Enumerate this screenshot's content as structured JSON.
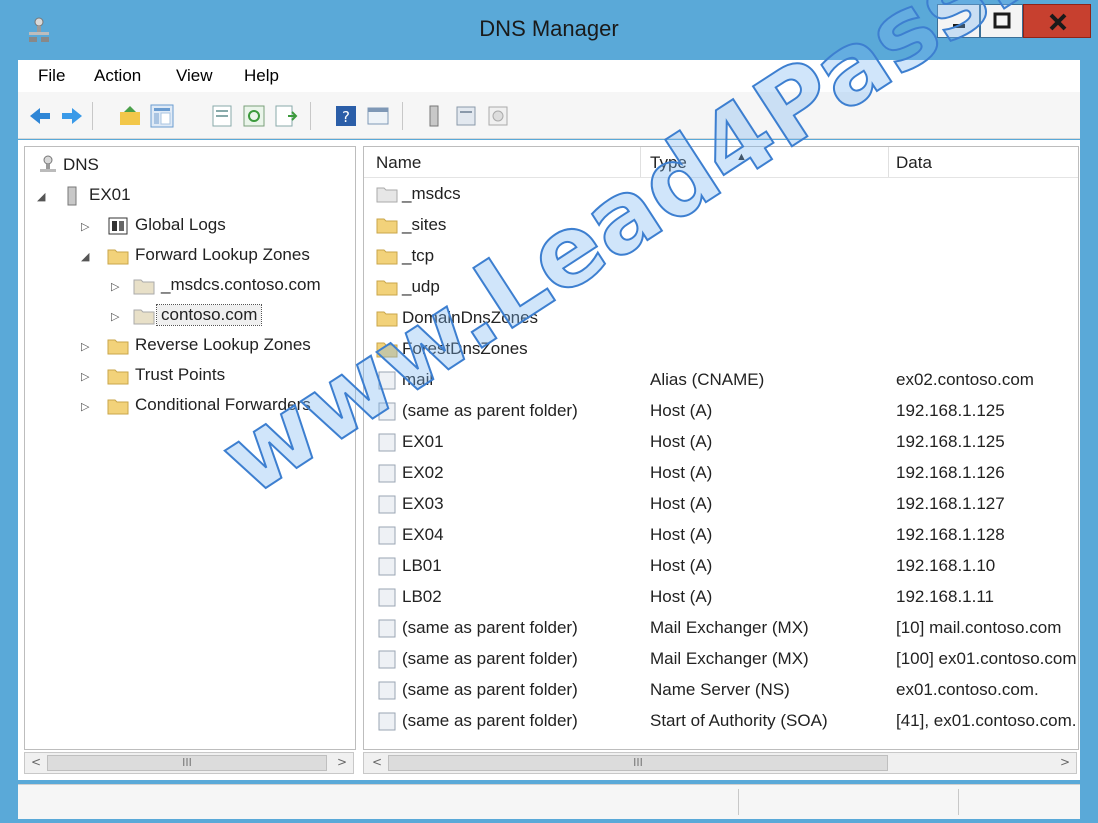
{
  "window": {
    "title": "DNS Manager"
  },
  "menu": [
    "File",
    "Action",
    "View",
    "Help"
  ],
  "toolbar": {
    "icons": [
      "back-arrow-icon",
      "forward-arrow-icon",
      "up-folder-icon",
      "show-hide-tree-icon",
      "properties-icon",
      "refresh-icon",
      "export-list-icon",
      "help-icon",
      "console-icon",
      "server-icon",
      "zone-icon",
      "record-icon"
    ]
  },
  "tree": {
    "root": "DNS",
    "server": "EX01",
    "global_logs": "Global Logs",
    "forward_zones": "Forward Lookup Zones",
    "msdcs_zone": "_msdcs.contoso.com",
    "contoso_zone": "contoso.com",
    "reverse_zones": "Reverse Lookup Zones",
    "trust_points": "Trust Points",
    "conditional_forwarders": "Conditional Forwarders"
  },
  "list": {
    "columns": {
      "name": "Name",
      "type": "Type",
      "data": "Data"
    },
    "rows": [
      {
        "name": "_msdcs",
        "type": "",
        "data": "",
        "icon": "delegated-folder-icon"
      },
      {
        "name": "_sites",
        "type": "",
        "data": "",
        "icon": "folder-icon"
      },
      {
        "name": "_tcp",
        "type": "",
        "data": "",
        "icon": "folder-icon"
      },
      {
        "name": "_udp",
        "type": "",
        "data": "",
        "icon": "folder-icon"
      },
      {
        "name": "DomainDnsZones",
        "type": "",
        "data": "",
        "icon": "folder-icon"
      },
      {
        "name": "ForestDnsZones",
        "type": "",
        "data": "",
        "icon": "folder-icon"
      },
      {
        "name": "mail",
        "type": "Alias (CNAME)",
        "data": "ex02.contoso.com",
        "icon": "record-icon"
      },
      {
        "name": "(same as parent folder)",
        "type": "Host (A)",
        "data": "192.168.1.125",
        "icon": "record-icon"
      },
      {
        "name": "EX01",
        "type": "Host (A)",
        "data": "192.168.1.125",
        "icon": "record-icon"
      },
      {
        "name": "EX02",
        "type": "Host (A)",
        "data": "192.168.1.126",
        "icon": "record-icon"
      },
      {
        "name": "EX03",
        "type": "Host (A)",
        "data": "192.168.1.127",
        "icon": "record-icon"
      },
      {
        "name": "EX04",
        "type": "Host (A)",
        "data": "192.168.1.128",
        "icon": "record-icon"
      },
      {
        "name": "LB01",
        "type": "Host (A)",
        "data": "192.168.1.10",
        "icon": "record-icon"
      },
      {
        "name": "LB02",
        "type": "Host (A)",
        "data": "192.168.1.11",
        "icon": "record-icon"
      },
      {
        "name": "(same as parent folder)",
        "type": "Mail Exchanger (MX)",
        "data": "[10]  mail.contoso.com",
        "icon": "record-icon"
      },
      {
        "name": "(same as parent folder)",
        "type": "Mail Exchanger (MX)",
        "data": "[100]  ex01.contoso.com",
        "icon": "record-icon"
      },
      {
        "name": "(same as parent folder)",
        "type": "Name Server (NS)",
        "data": "ex01.contoso.com.",
        "icon": "record-icon"
      },
      {
        "name": "(same as parent folder)",
        "type": "Start of Authority (SOA)",
        "data": "[41], ex01.contoso.com.,",
        "icon": "record-icon"
      }
    ]
  },
  "scroll": {
    "thumb_grip": "III"
  },
  "watermark": "www.Lead4Pass.com",
  "colors": {
    "titlebar": "#5aa9d8",
    "close": "#c7402f",
    "folder": "#f2d27a"
  }
}
